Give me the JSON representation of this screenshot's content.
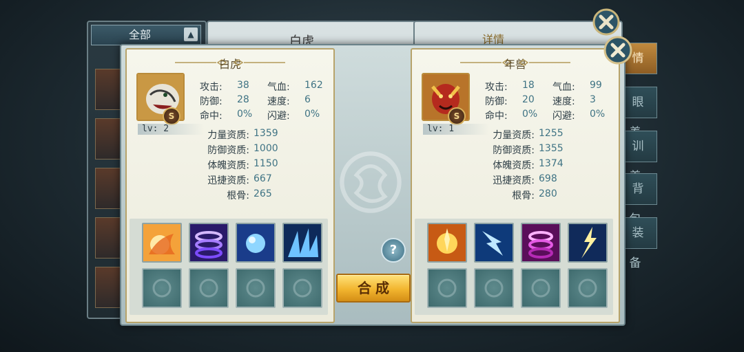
{
  "background": {
    "filter_label": "全部",
    "center_title": "白虎",
    "right_title": "详情",
    "side_tabs": [
      "情",
      "眼 养",
      "训 养",
      "背 包",
      "装 备"
    ]
  },
  "left_pet": {
    "name": "白虎",
    "rank": "S",
    "level": "lv: 2",
    "stats": [
      {
        "k1": "攻击:",
        "v1": "38",
        "k2": "气血:",
        "v2": "162"
      },
      {
        "k1": "防御:",
        "v1": "28",
        "k2": "速度:",
        "v2": "6"
      },
      {
        "k1": "命中:",
        "v1": "0%",
        "k2": "闪避:",
        "v2": "0%"
      }
    ],
    "aptitudes": [
      {
        "k": "力量资质:",
        "v": "1359"
      },
      {
        "k": "防御资质:",
        "v": "1000"
      },
      {
        "k": "体魄资质:",
        "v": "1150"
      },
      {
        "k": "迅捷资质:",
        "v": "667"
      },
      {
        "k": "根骨:",
        "v": "265"
      }
    ]
  },
  "right_pet": {
    "name": "年兽",
    "rank": "S",
    "level": "lv: 1",
    "stats": [
      {
        "k1": "攻击:",
        "v1": "18",
        "k2": "气血:",
        "v2": "99"
      },
      {
        "k1": "防御:",
        "v1": "20",
        "k2": "速度:",
        "v2": "3"
      },
      {
        "k1": "命中:",
        "v1": "0%",
        "k2": "闪避:",
        "v2": "0%"
      }
    ],
    "aptitudes": [
      {
        "k": "力量资质:",
        "v": "1255"
      },
      {
        "k": "防御资质:",
        "v": "1355"
      },
      {
        "k": "体魄资质:",
        "v": "1374"
      },
      {
        "k": "迅捷资质:",
        "v": "698"
      },
      {
        "k": "根骨:",
        "v": "280"
      }
    ]
  },
  "actions": {
    "help": "?",
    "combine": "合成"
  },
  "colors": {
    "accent_gold": "#f2b52f",
    "value_blue": "#3f7384",
    "panel_cream": "#f6f6ec"
  }
}
